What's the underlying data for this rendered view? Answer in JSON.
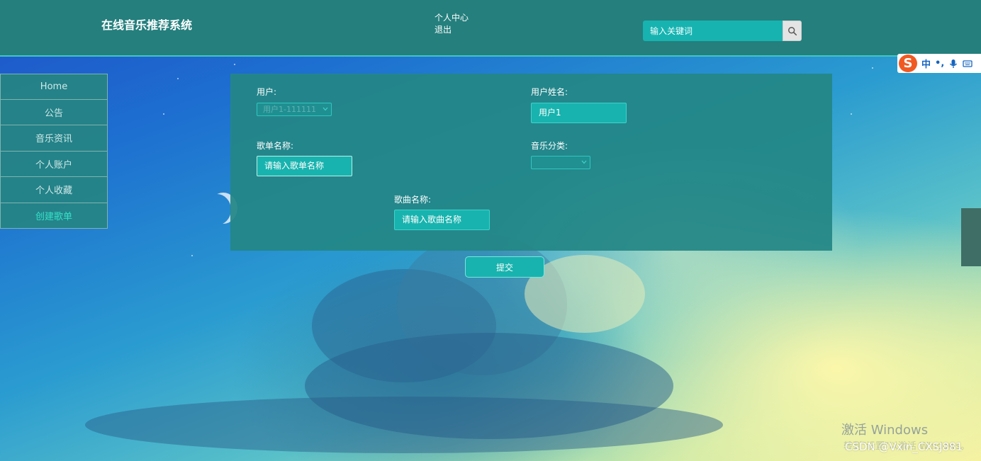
{
  "header": {
    "site_title": "在线音乐推荐系统",
    "user_center": "个人中心",
    "logout": "退出",
    "search_placeholder": "输入关键词",
    "search_icon": "search-icon"
  },
  "ime": {
    "logo": "S",
    "lang": "中",
    "punct": "•,"
  },
  "sidebar": {
    "items": [
      {
        "label": "Home",
        "active": false
      },
      {
        "label": "公告",
        "active": false
      },
      {
        "label": "音乐资讯",
        "active": false
      },
      {
        "label": "个人账户",
        "active": false
      },
      {
        "label": "个人收藏",
        "active": false
      },
      {
        "label": "创建歌单",
        "active": true
      }
    ],
    "active_color": "#35e0c9"
  },
  "form": {
    "user_label": "用户:",
    "user_select_value": "用户1-111111",
    "user_name_label": "用户姓名:",
    "user_name_value": "用户1",
    "playlist_label": "歌单名称:",
    "playlist_placeholder": "请输入歌单名称",
    "category_label": "音乐分类:",
    "category_value": "",
    "song_label": "歌曲名称:",
    "song_placeholder": "请输入歌曲名称",
    "submit_label": "提交"
  },
  "watermarks": {
    "activate_title": "激活 Windows",
    "activate_sub": "转到\"设置\"以激活 Windows。",
    "csdn": "CSDN @Vxin_CXSJ881"
  },
  "colors": {
    "header_bg": "#247f7d",
    "accent": "#18b3ae",
    "panel_bg": "#238785"
  }
}
